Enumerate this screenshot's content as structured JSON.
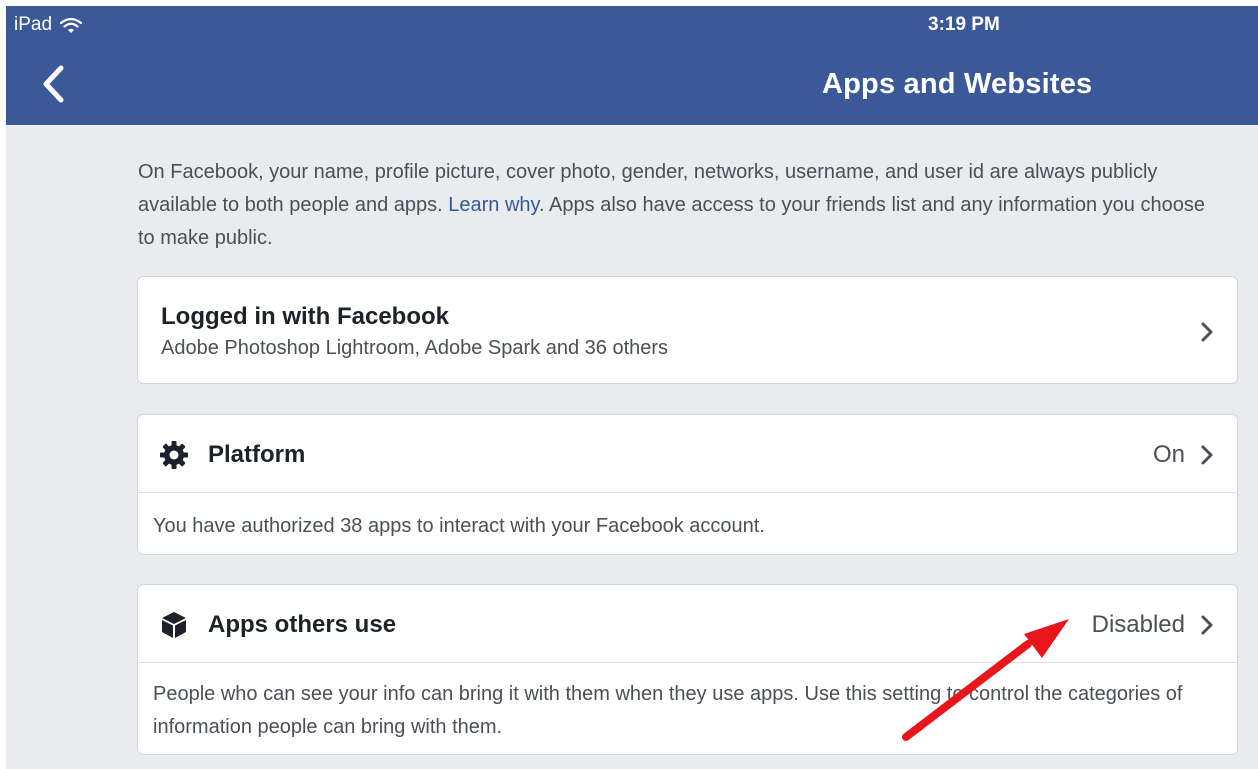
{
  "status_bar": {
    "device": "iPad",
    "time": "3:19 PM"
  },
  "navbar": {
    "title": "Apps and Websites",
    "back_icon": "chevron-left-icon"
  },
  "intro": {
    "text_before_link": "On Facebook, your name, profile picture, cover photo, gender, networks, username, and user id are always publicly available to both people and apps. ",
    "link": "Learn why",
    "text_after_link": ". Apps also have access to your friends list and any information you choose to make public."
  },
  "logged_in": {
    "title": "Logged in with Facebook",
    "subtitle": "Adobe Photoshop Lightroom, Adobe Spark and 36 others"
  },
  "platform": {
    "icon": "gear-icon",
    "title": "Platform",
    "value": "On",
    "description": "You have authorized 38 apps to interact with your Facebook account."
  },
  "apps_others_use": {
    "icon": "cube-icon",
    "title": "Apps others use",
    "value": "Disabled",
    "description": "People who can see your info can bring it with them when they use apps. Use this setting to control the categories of information people can bring with them."
  },
  "colors": {
    "navbar": "#3b5998",
    "background": "#e9ebee",
    "link": "#365899",
    "annotation_arrow": "#e8151b"
  }
}
